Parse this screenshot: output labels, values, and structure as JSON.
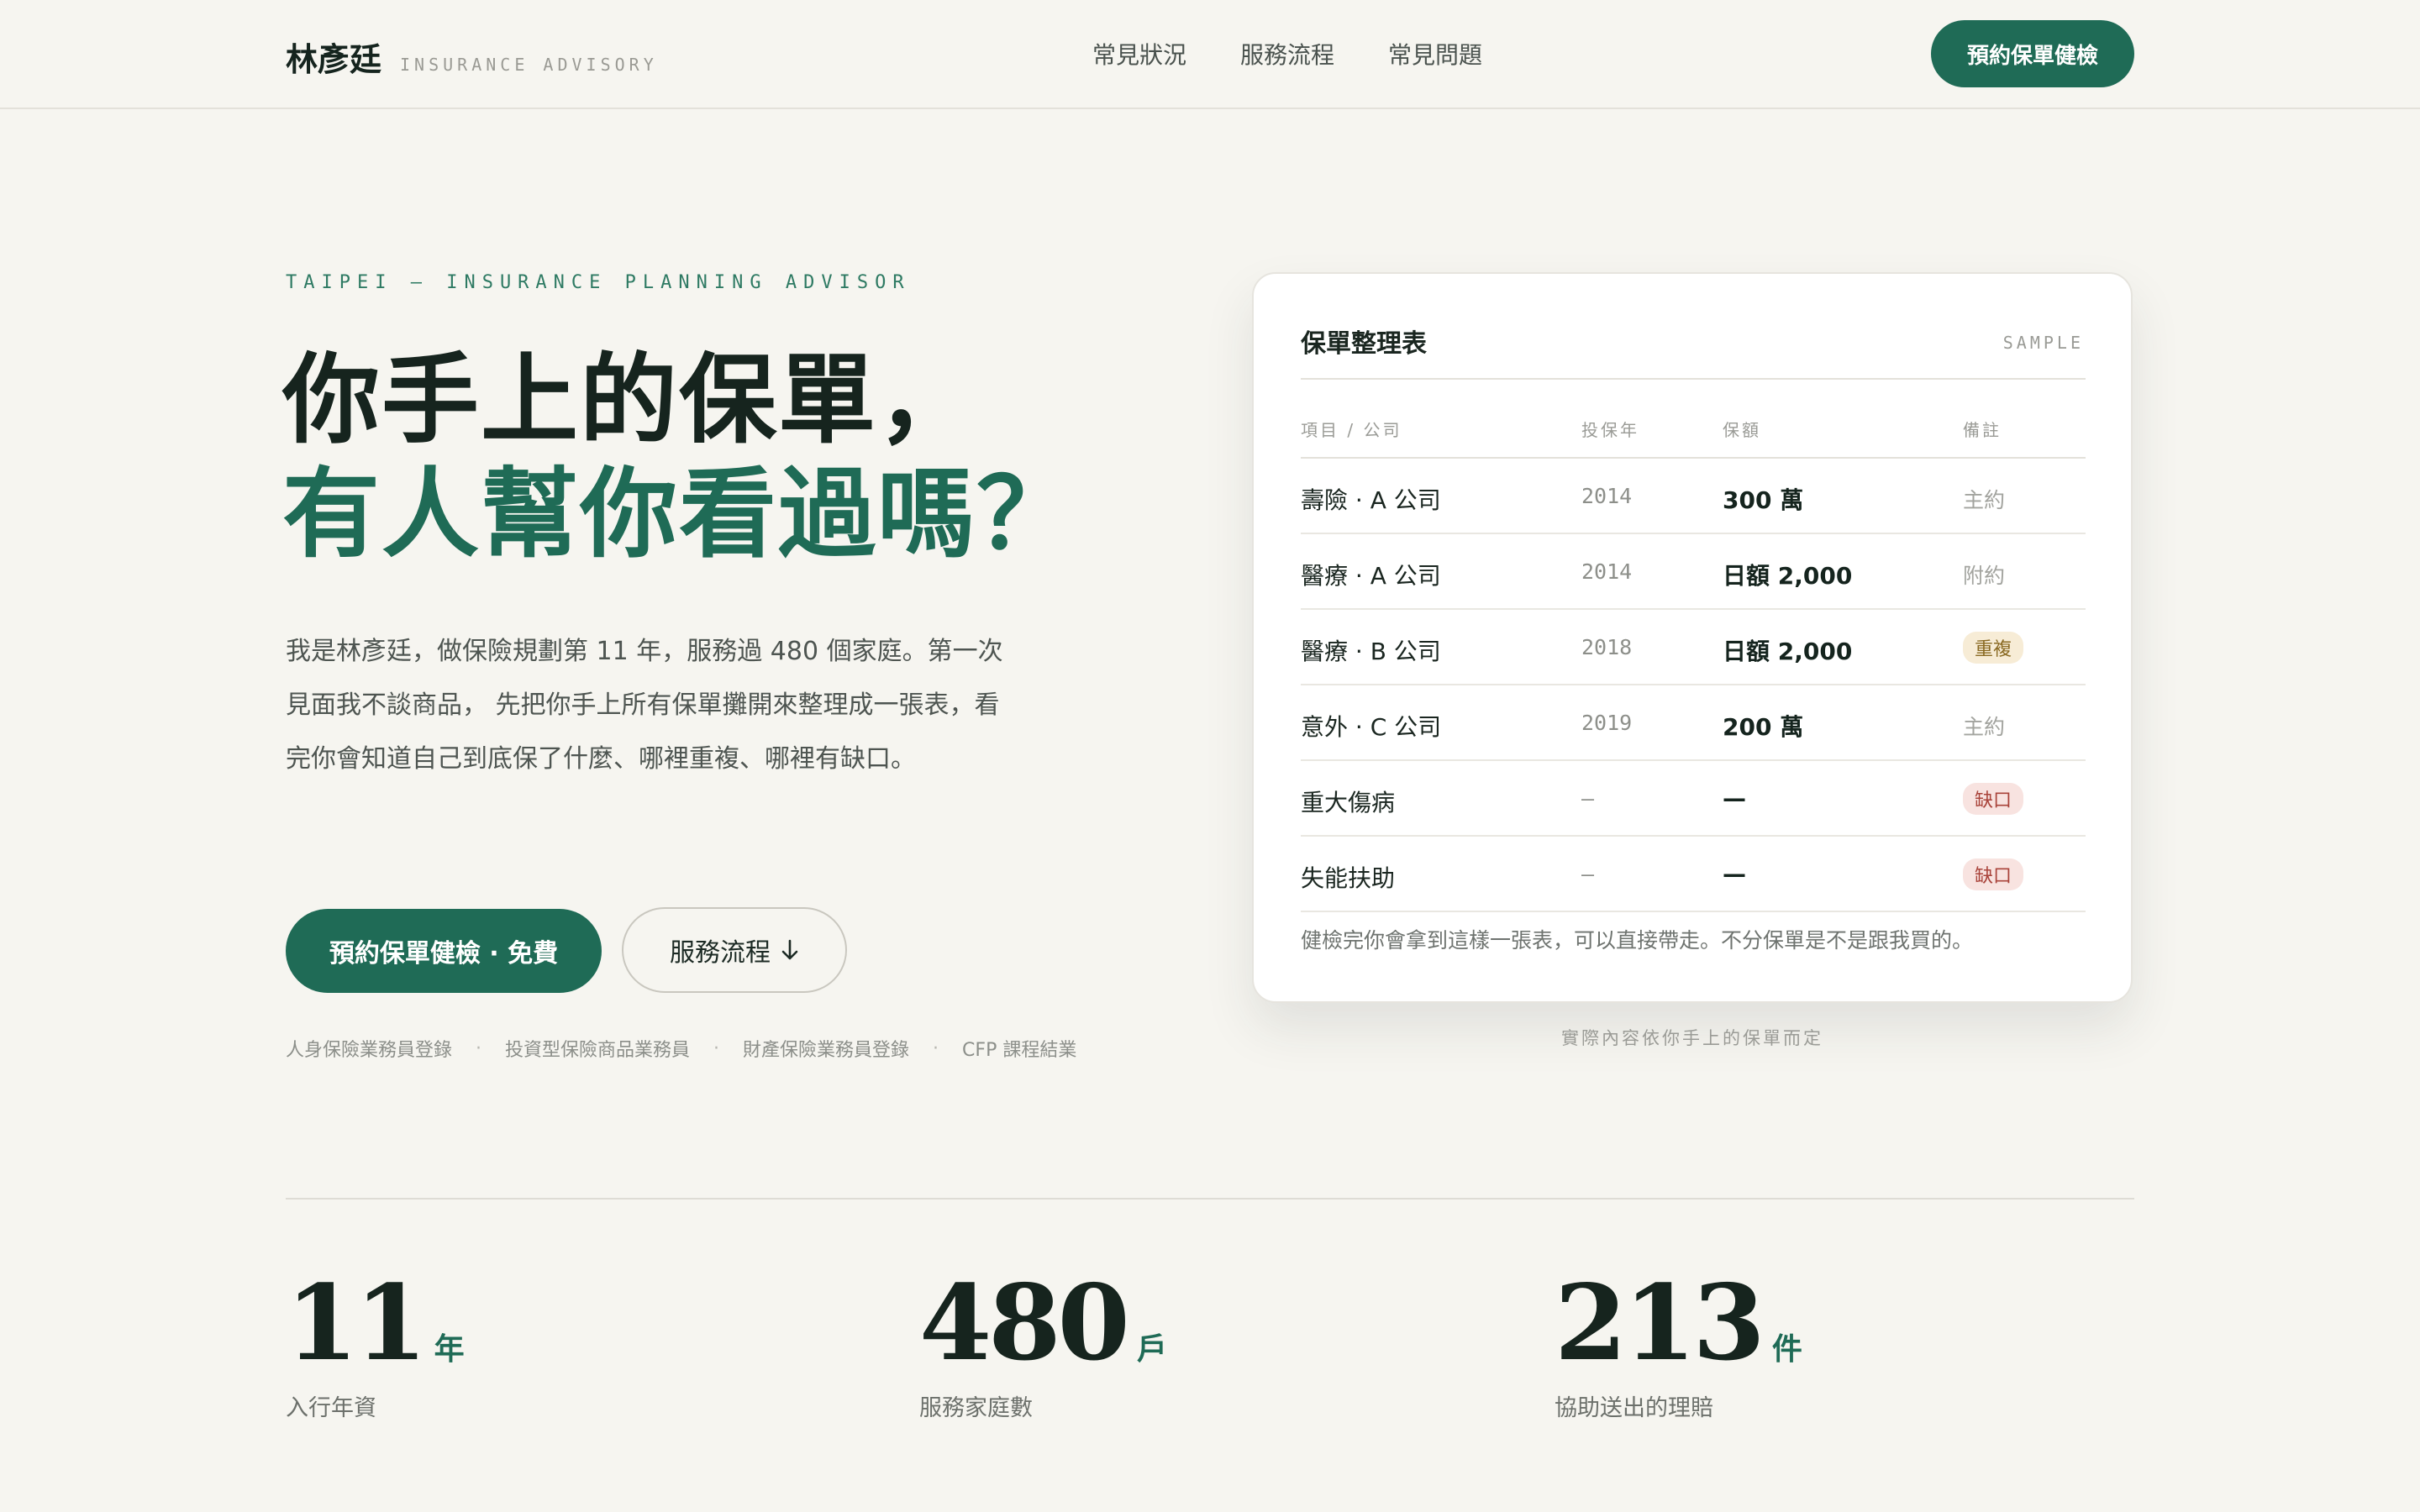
{
  "header": {
    "brand_name": "林彥廷",
    "brand_sub": "INSURANCE ADVISORY",
    "nav": [
      "常見狀況",
      "服務流程",
      "常見問題"
    ],
    "cta": "預約保單健檢"
  },
  "hero": {
    "eyebrow": "TAIPEI — INSURANCE PLANNING ADVISOR",
    "title_line1": "你手上的保單，",
    "title_line2": "有人幫你看過嗎？",
    "intro": "我是林彥廷，做保險規劃第 11 年，服務過 480 個家庭。第一次見面我不談商品， 先把你手上所有保單攤開來整理成一張表，看完你會知道自己到底保了什麼、哪裡重複、哪裡有缺口。",
    "primary_button": "預約保單健檢 · 免費",
    "secondary_button": "服務流程",
    "secondary_icon": "arrow-down-icon",
    "credentials": [
      "人身保險業務員登錄",
      "投資型保險商品業務員",
      "財產保險業務員登錄",
      "CFP 課程結業"
    ]
  },
  "card": {
    "title": "保單整理表",
    "tag": "SAMPLE",
    "columns": [
      "項目 / 公司",
      "投保年",
      "保額",
      "備註"
    ],
    "rows": [
      {
        "item": "壽險 · A 公司",
        "year": "2014",
        "amount": "300 萬",
        "note": "主約",
        "note_type": "plain"
      },
      {
        "item": "醫療 · A 公司",
        "year": "2014",
        "amount": "日額 2,000",
        "note": "附約",
        "note_type": "plain"
      },
      {
        "item": "醫療 · B 公司",
        "year": "2018",
        "amount": "日額 2,000",
        "note": "重複",
        "note_type": "dup"
      },
      {
        "item": "意外 · C 公司",
        "year": "2019",
        "amount": "200 萬",
        "note": "主約",
        "note_type": "plain"
      },
      {
        "item": "重大傷病",
        "year": "–",
        "amount": "—",
        "note": "缺口",
        "note_type": "gap"
      },
      {
        "item": "失能扶助",
        "year": "–",
        "amount": "—",
        "note": "缺口",
        "note_type": "gap"
      }
    ],
    "note": "健檢完你會拿到這樣一張表，可以直接帶走。不分保單是不是跟我買的。",
    "caption": "實際內容依你手上的保單而定"
  },
  "stats": [
    {
      "value": "11",
      "unit": "年",
      "label": "入行年資"
    },
    {
      "value": "480",
      "unit": "戶",
      "label": "服務家庭數"
    },
    {
      "value": "213",
      "unit": "件",
      "label": "協助送出的理賠"
    }
  ],
  "colors": {
    "accent": "#1f6b56",
    "background": "#f6f5f0"
  }
}
